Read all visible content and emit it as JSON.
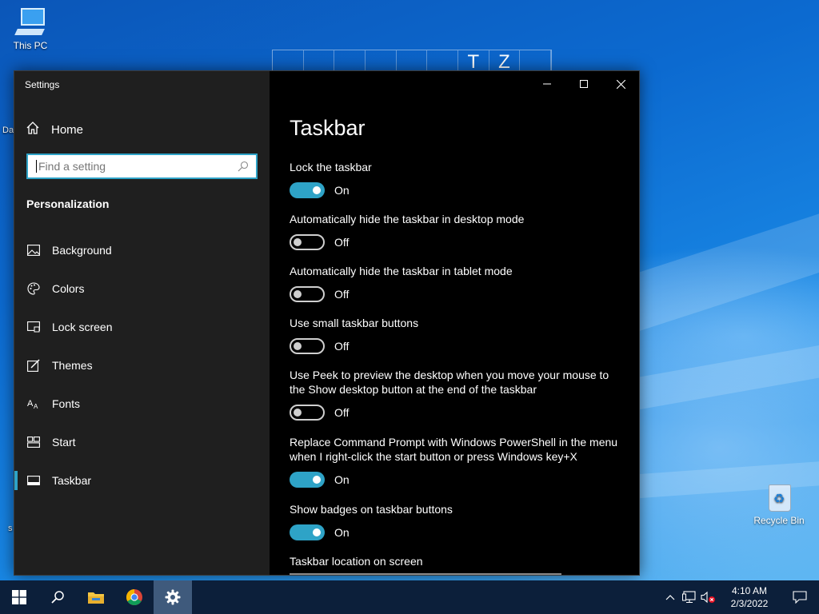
{
  "desktop": {
    "this_pc_label": "This PC",
    "recycle_bin_label": "Recycle Bin",
    "edge_text_1": "Da",
    "edge_text_2": "s",
    "wallpaper_letters": [
      "",
      "",
      "",
      "",
      "",
      "",
      "T",
      "Z",
      ""
    ]
  },
  "window": {
    "app_title": "Settings",
    "home_label": "Home",
    "search_placeholder": "Find a setting",
    "section_heading": "Personalization",
    "nav_items": [
      {
        "label": "Background",
        "icon": "image-icon"
      },
      {
        "label": "Colors",
        "icon": "palette-icon"
      },
      {
        "label": "Lock screen",
        "icon": "lock-screen-icon"
      },
      {
        "label": "Themes",
        "icon": "brush-icon"
      },
      {
        "label": "Fonts",
        "icon": "font-icon"
      },
      {
        "label": "Start",
        "icon": "start-icon"
      },
      {
        "label": "Taskbar",
        "icon": "taskbar-icon",
        "active": true
      }
    ],
    "page_title": "Taskbar",
    "settings": [
      {
        "label": "Lock the taskbar",
        "state": "On",
        "on": true
      },
      {
        "label": "Automatically hide the taskbar in desktop mode",
        "state": "Off",
        "on": false
      },
      {
        "label": "Automatically hide the taskbar in tablet mode",
        "state": "Off",
        "on": false
      },
      {
        "label": "Use small taskbar buttons",
        "state": "Off",
        "on": false
      },
      {
        "label_line1": "Use Peek to preview the desktop when you move your mouse to",
        "label_line2": "the Show desktop button at the end of the taskbar",
        "state": "Off",
        "on": false
      },
      {
        "label_line1": "Replace Command Prompt with Windows PowerShell in the menu",
        "label_line2": "when I right-click the start button or press Windows key+X",
        "state": "On",
        "on": true
      },
      {
        "label": "Show badges on taskbar buttons",
        "state": "On",
        "on": true
      }
    ],
    "location_label": "Taskbar location on screen"
  },
  "taskbar": {
    "apps": [
      "windows-start-icon",
      "search-icon",
      "file-explorer-icon",
      "chrome-icon",
      "settings-gear-icon"
    ],
    "time": "4:10 AM",
    "date": "2/3/2022"
  },
  "colors": {
    "accent": "#2ea3c7",
    "sidebar_bg": "#1f1f1f",
    "content_bg": "#000000",
    "taskbar_bg": "#0c1f3a"
  }
}
